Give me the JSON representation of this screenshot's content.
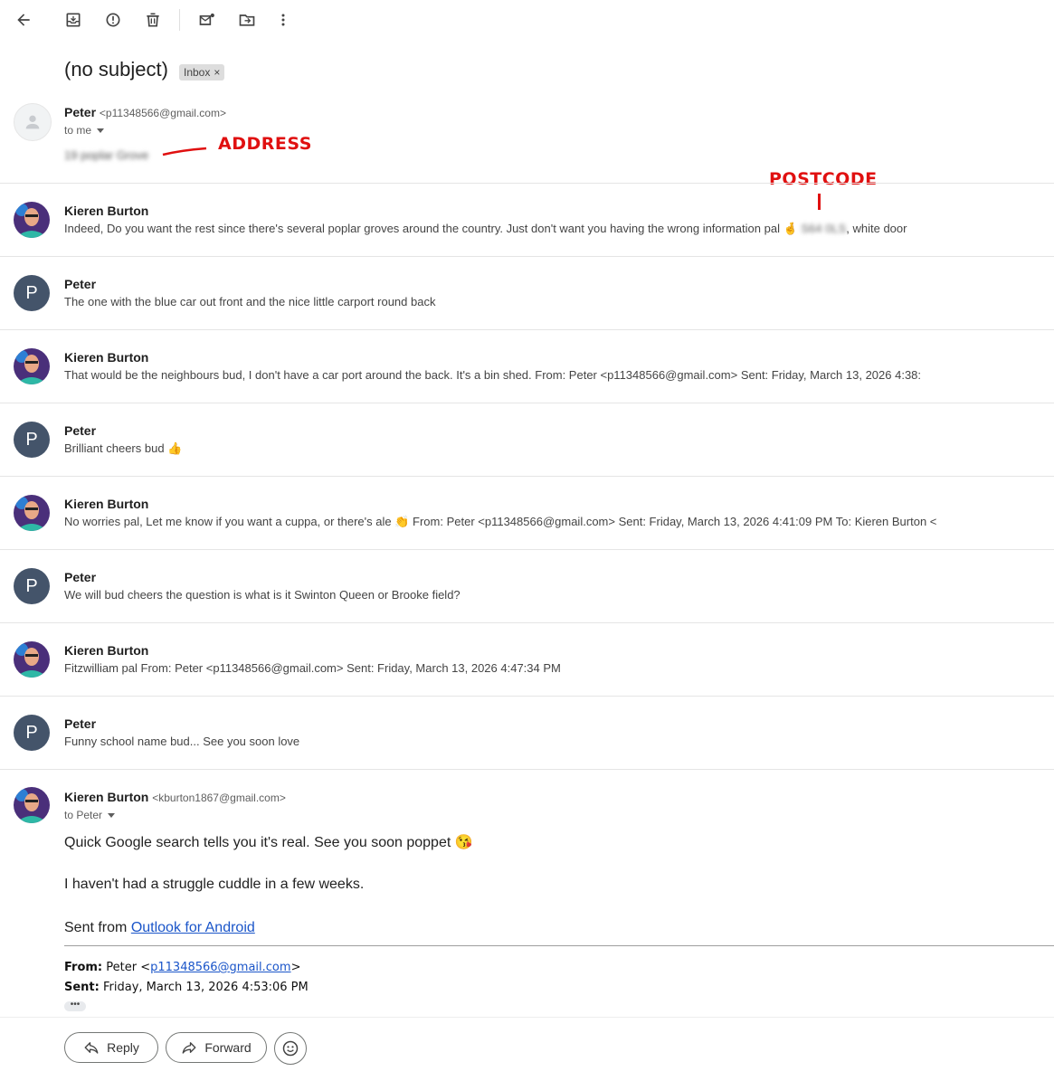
{
  "toolbar": {
    "icons": [
      "back-arrow-icon",
      "archive-icon",
      "report-spam-icon",
      "delete-icon",
      "mark-unread-icon",
      "move-to-icon",
      "more-vert-icon"
    ]
  },
  "thread": {
    "subject": "(no subject)",
    "label": "Inbox",
    "label_remove": "×"
  },
  "first_message": {
    "sender_name": "Peter",
    "sender_email": "<p11348566@gmail.com>",
    "to": "to me",
    "blurred_address": "19 poplar Grove"
  },
  "annotations": {
    "address": "ADDRESS",
    "postcode": "POSTCODE"
  },
  "collapsed_messages": [
    {
      "name": "Kieren Burton",
      "snippet": "Indeed, Do you want the rest since there's several poplar groves around the country. Just don't want you having the wrong information pal 🤞",
      "postcode": "S64 0LS",
      "snippet_tail": ", white door"
    },
    {
      "name": "Peter",
      "initial": "P",
      "snippet": "The one with the blue car out front and the nice little carport round back"
    },
    {
      "name": "Kieren Burton",
      "snippet": "That would be the neighbours bud, I don't have a car port around the back. It's a bin shed. From: Peter <p11348566@gmail.com> Sent: Friday, March 13, 2026 4:38:"
    },
    {
      "name": "Peter",
      "initial": "P",
      "snippet": "Brilliant cheers bud 👍"
    },
    {
      "name": "Kieren Burton",
      "snippet": "No worries pal, Let me know if you want a cuppa, or there's ale 👏 From: Peter <p11348566@gmail.com> Sent: Friday, March 13, 2026 4:41:09 PM To: Kieren Burton <"
    },
    {
      "name": "Peter",
      "initial": "P",
      "snippet": "We will bud cheers the question is what is it Swinton Queen or Brooke field?"
    },
    {
      "name": "Kieren Burton",
      "snippet": "Fitzwilliam pal From: Peter <p11348566@gmail.com> Sent: Friday, March 13, 2026 4:47:34 PM"
    },
    {
      "name": "Peter",
      "initial": "P",
      "snippet": "Funny school name bud... See you soon love"
    }
  ],
  "last_message": {
    "sender_name": "Kieren Burton",
    "sender_email": "<kburton1867@gmail.com>",
    "to": "to Peter",
    "line1": "Quick Google search tells you it's real. See you soon poppet 😘",
    "line2": "I haven't had a struggle cuddle in a few weeks.",
    "sent_from_prefix": "Sent from ",
    "sent_from_link": "Outlook for Android",
    "quote_from_label": "From:",
    "quote_from_name": " Peter <",
    "quote_from_email": "p11348566@gmail.com",
    "quote_from_close": ">",
    "quote_sent_label": "Sent:",
    "quote_sent_value": " Friday, March 13, 2026 4:53:06 PM",
    "ellipsis": "•••"
  },
  "actions": {
    "reply": "Reply",
    "forward": "Forward"
  },
  "colors": {
    "annotation": "#e01010",
    "avatar_p": "#44546a",
    "link": "#1a55c9"
  }
}
